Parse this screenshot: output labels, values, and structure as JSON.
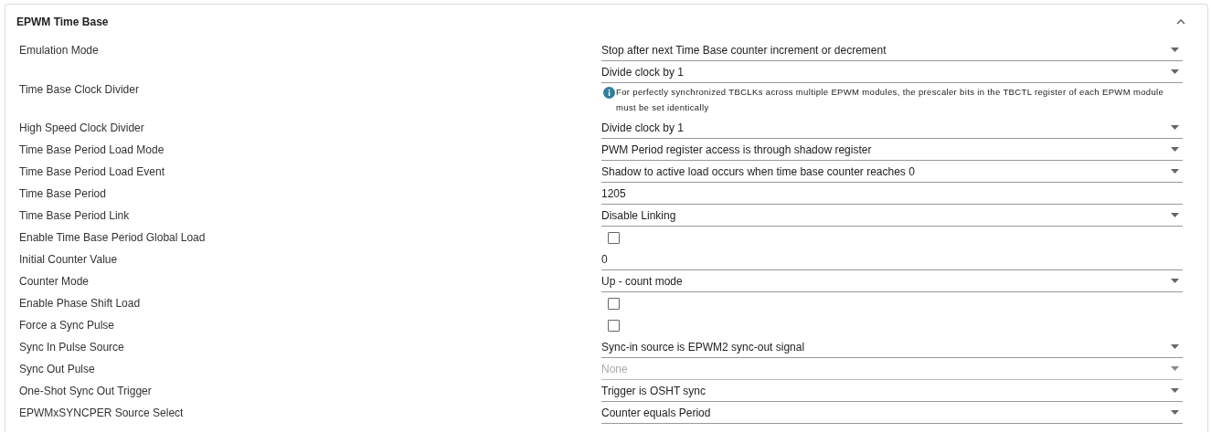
{
  "panel": {
    "title": "EPWM Time Base",
    "expanded": true
  },
  "rows": [
    {
      "label": "Emulation Mode",
      "kind": "select",
      "value": "Stop after next Time Base counter increment or decrement",
      "disabled": false
    },
    {
      "label": "Time Base Clock Divider",
      "kind": "select",
      "value": "Divide clock by 1",
      "disabled": false,
      "note": "For perfectly synchronized TBCLKs across multiple EPWM modules, the prescaler bits in the TBCTL register of each EPWM module must be set identically"
    },
    {
      "label": "High Speed Clock Divider",
      "kind": "select",
      "value": "Divide clock by 1",
      "disabled": false
    },
    {
      "label": "Time Base Period Load Mode",
      "kind": "select",
      "value": "PWM Period register access is through shadow register",
      "disabled": false
    },
    {
      "label": "Time Base Period Load Event",
      "kind": "select",
      "value": "Shadow to active load occurs when time base counter reaches 0",
      "disabled": false
    },
    {
      "label": "Time Base Period",
      "kind": "text",
      "value": "1205"
    },
    {
      "label": "Time Base Period Link",
      "kind": "select",
      "value": "Disable Linking",
      "disabled": false
    },
    {
      "label": "Enable Time Base Period Global Load",
      "kind": "checkbox",
      "checked": false
    },
    {
      "label": "Initial Counter Value",
      "kind": "text",
      "value": "0"
    },
    {
      "label": "Counter Mode",
      "kind": "select",
      "value": "Up - count mode",
      "disabled": false
    },
    {
      "label": "Enable Phase Shift Load",
      "kind": "checkbox",
      "checked": false
    },
    {
      "label": "Force a Sync Pulse",
      "kind": "checkbox",
      "checked": false
    },
    {
      "label": "Sync In Pulse Source",
      "kind": "select",
      "value": "Sync-in source is EPWM2 sync-out signal",
      "disabled": false
    },
    {
      "label": "Sync Out Pulse",
      "kind": "select",
      "value": "None",
      "disabled": true
    },
    {
      "label": "One-Shot Sync Out Trigger",
      "kind": "select",
      "value": "Trigger is OSHT sync",
      "disabled": false
    },
    {
      "label": "EPWMxSYNCPER Source Select",
      "kind": "select",
      "value": "Counter equals Period",
      "disabled": false
    }
  ]
}
